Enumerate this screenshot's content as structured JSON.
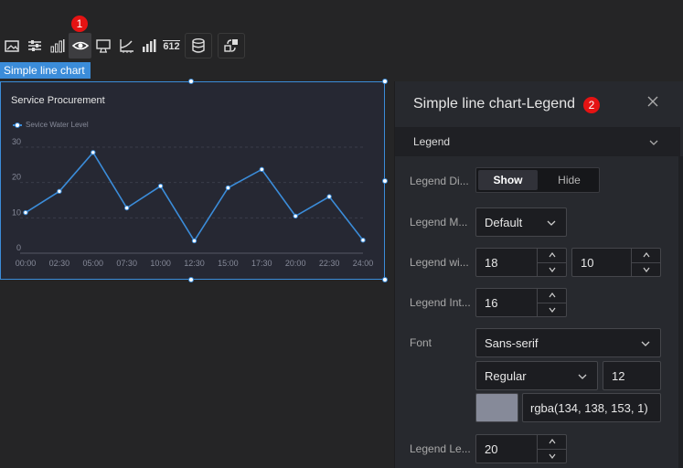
{
  "badges": {
    "one": "1",
    "two": "2"
  },
  "toolbar": {
    "items": [
      "image-icon",
      "sliders-icon",
      "bar-chart-icon",
      "eye-icon",
      "monitor-icon",
      "axis-icon",
      "bar-small-icon",
      "number-icon",
      "database-icon",
      "interaction-icon"
    ],
    "number_label": "612"
  },
  "chart_tag": "Simple line chart",
  "chart_data": {
    "type": "line",
    "title": "Service Procurement",
    "categories": [
      "00:00",
      "02:30",
      "05:00",
      "07:30",
      "10:00",
      "12:30",
      "15:00",
      "17:30",
      "20:00",
      "22:30",
      "24:00"
    ],
    "series": [
      {
        "name": "Sevice Water Level",
        "values": [
          11.5,
          17.5,
          28.5,
          12.8,
          19,
          3.5,
          18.5,
          23.7,
          10.5,
          16,
          3.7
        ]
      }
    ],
    "yticks": [
      0,
      10,
      20,
      30
    ],
    "ylim": [
      0,
      30
    ],
    "grid": true,
    "legend_position": "top-left",
    "line_color": "#3b8cd9"
  },
  "panel": {
    "title": "Simple line chart-Legend",
    "section": "Legend",
    "display_label": "Legend Di...",
    "display_show": "Show",
    "display_hide": "Hide",
    "mode_label": "Legend M...",
    "mode_value": "Default",
    "width_label": "Legend wi...",
    "width_value": "18",
    "height_value": "10",
    "interval_label": "Legend Int...",
    "interval_value": "16",
    "font_label": "Font",
    "font_family": "Sans-serif",
    "font_weight": "Regular",
    "font_size": "12",
    "font_color_value": "rgba(134, 138, 153, 1)",
    "font_color": "#868a99",
    "length_label": "Legend Le...",
    "length_value": "20"
  }
}
